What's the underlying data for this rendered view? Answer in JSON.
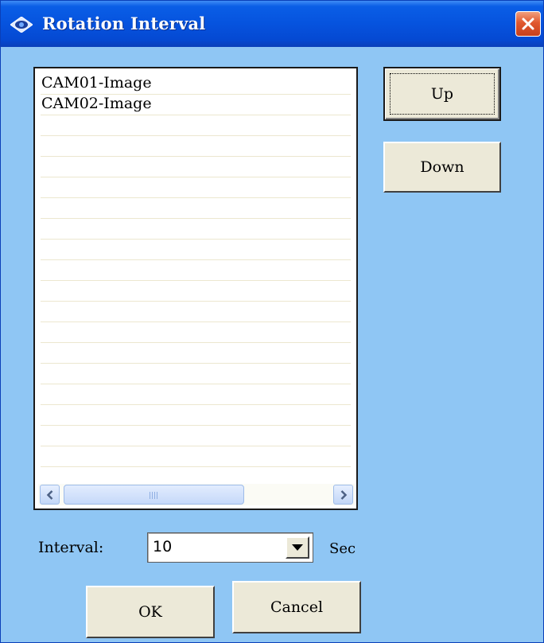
{
  "window": {
    "title": "Rotation Interval",
    "title_icon": "diamond-eye-icon",
    "close_icon": "close-icon",
    "colors": {
      "titlebar": "#0653de",
      "client_bg": "#8fc6f4",
      "close": "#e1582e"
    }
  },
  "list": {
    "items": [
      "CAM01-Image",
      "CAM02-Image"
    ]
  },
  "scrollbar": {
    "left_icon": "chevron-left-icon",
    "right_icon": "chevron-right-icon"
  },
  "buttons": {
    "up": "Up",
    "down": "Down",
    "ok": "OK",
    "cancel": "Cancel"
  },
  "interval": {
    "label": "Interval:",
    "value": "10",
    "unit": "Sec",
    "dropdown_icon": "triangle-down-icon"
  }
}
